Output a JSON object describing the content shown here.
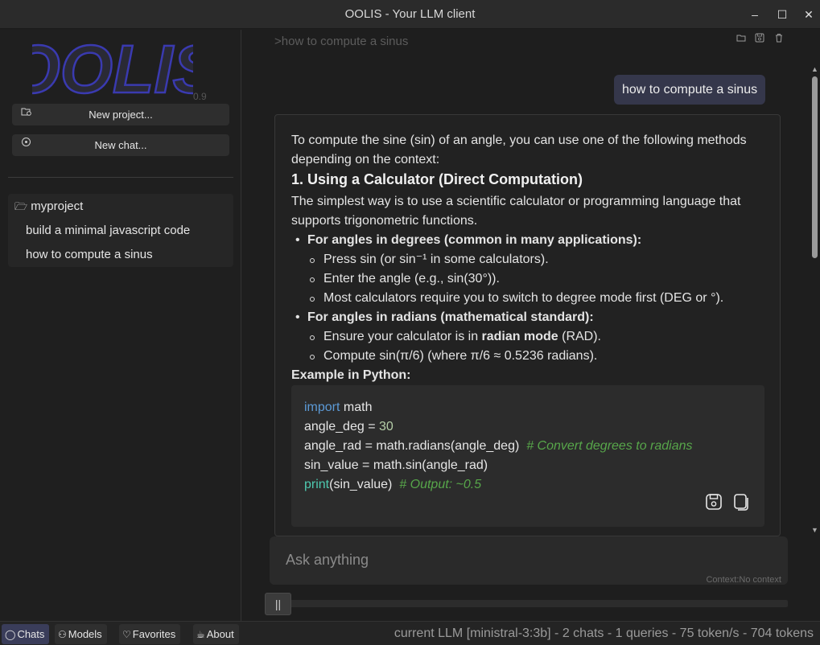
{
  "window": {
    "title": "OOLIS - Your LLM client",
    "controls": {
      "minimize": "–",
      "maximize": "☐",
      "close": "✕"
    }
  },
  "sidebar": {
    "logo_text": "OOLIS",
    "version": "0.9",
    "new_project_label": "New project...",
    "new_chat_label": "New chat...",
    "project": {
      "name": "myproject",
      "chats": [
        "build a minimal javascript code",
        "how to compute a sinus"
      ]
    }
  },
  "main": {
    "conversation_title": ">how to compute a sinus",
    "user_message": "how to compute a sinus",
    "answer": {
      "intro": "To compute the sine (sin) of an angle, you can use one of the following methods depending on the context:",
      "heading": "1. Using a Calculator (Direct Computation)",
      "paragraph": "The simplest way is to use a scientific calculator or programming language that supports trigonometric functions.",
      "degrees_title": "For angles in degrees (common in many applications):",
      "degrees_items": [
        "Press sin (or sin⁻¹ in some calculators).",
        "Enter the angle (e.g., sin(30°)).",
        "Most calculators require you to switch to degree mode first (DEG or °)."
      ],
      "radians_title": "For angles in radians (mathematical standard):",
      "radians_item1_pre": "Ensure your calculator is in ",
      "radians_item1_bold": "radian mode",
      "radians_item1_post": " (RAD).",
      "radians_item2": "Compute sin(π/6) (where π/6 ≈ 0.5236 radians).",
      "example_label": "Example in Python:",
      "code": {
        "l1_kw": "import",
        "l1_rest": " math",
        "l2_pre": "angle_deg = ",
        "l2_num": "30",
        "l3_code": "angle_rad = math.radians(angle_deg)  ",
        "l3_comment": "# Convert degrees to radians",
        "l4": "sin_value = math.sin(angle_rad)",
        "l5_fn": "print",
        "l5_rest": "(sin_value)  ",
        "l5_comment": "# Output: ~0.5"
      }
    },
    "input": {
      "placeholder": "Ask anything",
      "context_label": "Context:No context"
    },
    "slider_handle": "||"
  },
  "statusbar": {
    "tabs": [
      {
        "icon": "◯",
        "label": "Chats"
      },
      {
        "icon": "⚇",
        "label": "Models"
      },
      {
        "icon": "♡",
        "label": "Favorites"
      },
      {
        "icon": "☕",
        "label": "About"
      }
    ],
    "status_text": "current LLM [ministral-3:3b] - 2 chats - 1 queries - 75 token/s - 704 tokens"
  },
  "colors": {
    "accent_tab": "#3a3d5a",
    "user_bubble": "#35374b",
    "logo": "#3a3ab0",
    "keyword": "#5c9ad6",
    "comment": "#57a64a"
  }
}
